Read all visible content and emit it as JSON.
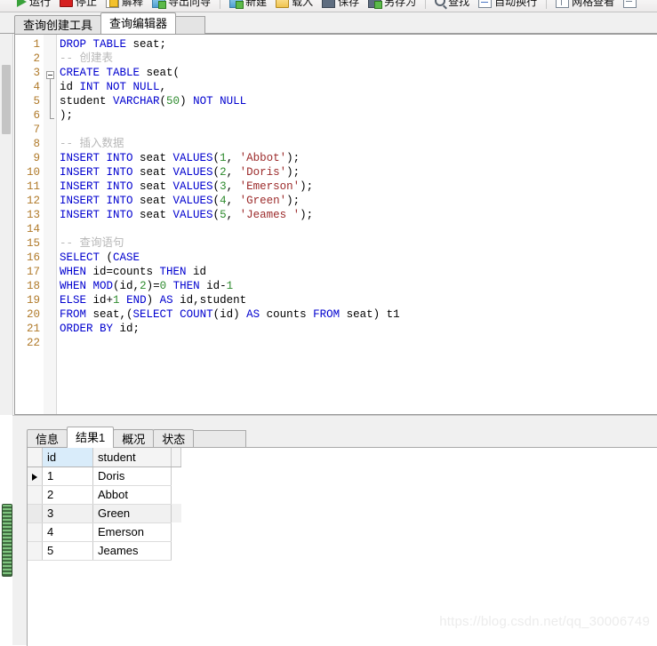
{
  "toolbar": {
    "groups": [
      {
        "items": [
          {
            "label": "运行",
            "icon": "run-icon"
          },
          {
            "label": "停止",
            "icon": "stop-icon"
          },
          {
            "label": "解释",
            "icon": "explain-icon"
          },
          {
            "label": "导出向导",
            "icon": "export-wizard-icon"
          }
        ]
      },
      {
        "items": [
          {
            "label": "新建",
            "icon": "new-icon"
          },
          {
            "label": "载入",
            "icon": "open-icon"
          },
          {
            "label": "保存",
            "icon": "save-icon"
          },
          {
            "label": "另存为",
            "icon": "save-as-icon"
          }
        ]
      },
      {
        "items": [
          {
            "label": "查找",
            "icon": "search-icon"
          },
          {
            "label": "自动换行",
            "icon": "word-wrap-icon"
          }
        ]
      },
      {
        "items": [
          {
            "label": "网格查看",
            "icon": "grid-view-icon"
          },
          {
            "label": "",
            "icon": "form-view-icon"
          }
        ]
      }
    ]
  },
  "tabs": [
    {
      "label": "查询创建工具",
      "active": false
    },
    {
      "label": "查询编辑器",
      "active": true
    }
  ],
  "editor": {
    "lines": [
      {
        "num": "1",
        "tokens": [
          {
            "t": "kw",
            "v": "DROP TABLE"
          },
          {
            "t": "p",
            "v": " seat;"
          }
        ]
      },
      {
        "num": "2",
        "tokens": [
          {
            "t": "cmt",
            "v": "-- 创建表"
          }
        ]
      },
      {
        "num": "3",
        "tokens": [
          {
            "t": "kw",
            "v": "CREATE TABLE"
          },
          {
            "t": "p",
            "v": " seat("
          }
        ],
        "fold": "start"
      },
      {
        "num": "4",
        "tokens": [
          {
            "t": "p",
            "v": "id "
          },
          {
            "t": "kw",
            "v": "INT NOT NULL"
          },
          {
            "t": "p",
            "v": ","
          }
        ],
        "fold": "mid"
      },
      {
        "num": "5",
        "tokens": [
          {
            "t": "p",
            "v": "student "
          },
          {
            "t": "kw",
            "v": "VARCHAR"
          },
          {
            "t": "p",
            "v": "("
          },
          {
            "t": "num",
            "v": "50"
          },
          {
            "t": "p",
            "v": ") "
          },
          {
            "t": "kw",
            "v": "NOT NULL"
          }
        ],
        "fold": "mid"
      },
      {
        "num": "6",
        "tokens": [
          {
            "t": "p",
            "v": ");"
          }
        ],
        "fold": "end"
      },
      {
        "num": "7",
        "tokens": []
      },
      {
        "num": "8",
        "tokens": [
          {
            "t": "cmt",
            "v": "-- 插入数据"
          }
        ]
      },
      {
        "num": "9",
        "tokens": [
          {
            "t": "kw",
            "v": "INSERT INTO"
          },
          {
            "t": "p",
            "v": " seat "
          },
          {
            "t": "kw",
            "v": "VALUES"
          },
          {
            "t": "p",
            "v": "("
          },
          {
            "t": "num",
            "v": "1"
          },
          {
            "t": "p",
            "v": ", "
          },
          {
            "t": "str",
            "v": "'Abbot'"
          },
          {
            "t": "p",
            "v": ");"
          }
        ]
      },
      {
        "num": "10",
        "tokens": [
          {
            "t": "kw",
            "v": "INSERT INTO"
          },
          {
            "t": "p",
            "v": " seat "
          },
          {
            "t": "kw",
            "v": "VALUES"
          },
          {
            "t": "p",
            "v": "("
          },
          {
            "t": "num",
            "v": "2"
          },
          {
            "t": "p",
            "v": ", "
          },
          {
            "t": "str",
            "v": "'Doris'"
          },
          {
            "t": "p",
            "v": ");"
          }
        ]
      },
      {
        "num": "11",
        "tokens": [
          {
            "t": "kw",
            "v": "INSERT INTO"
          },
          {
            "t": "p",
            "v": " seat "
          },
          {
            "t": "kw",
            "v": "VALUES"
          },
          {
            "t": "p",
            "v": "("
          },
          {
            "t": "num",
            "v": "3"
          },
          {
            "t": "p",
            "v": ", "
          },
          {
            "t": "str",
            "v": "'Emerson'"
          },
          {
            "t": "p",
            "v": ");"
          }
        ]
      },
      {
        "num": "12",
        "tokens": [
          {
            "t": "kw",
            "v": "INSERT INTO"
          },
          {
            "t": "p",
            "v": " seat "
          },
          {
            "t": "kw",
            "v": "VALUES"
          },
          {
            "t": "p",
            "v": "("
          },
          {
            "t": "num",
            "v": "4"
          },
          {
            "t": "p",
            "v": ", "
          },
          {
            "t": "str",
            "v": "'Green'"
          },
          {
            "t": "p",
            "v": ");"
          }
        ]
      },
      {
        "num": "13",
        "tokens": [
          {
            "t": "kw",
            "v": "INSERT INTO"
          },
          {
            "t": "p",
            "v": " seat "
          },
          {
            "t": "kw",
            "v": "VALUES"
          },
          {
            "t": "p",
            "v": "("
          },
          {
            "t": "num",
            "v": "5"
          },
          {
            "t": "p",
            "v": ", "
          },
          {
            "t": "str",
            "v": "'Jeames '"
          },
          {
            "t": "p",
            "v": ");"
          }
        ]
      },
      {
        "num": "14",
        "tokens": []
      },
      {
        "num": "15",
        "tokens": [
          {
            "t": "cmt",
            "v": "-- 查询语句"
          }
        ]
      },
      {
        "num": "16",
        "tokens": [
          {
            "t": "kw",
            "v": "SELECT"
          },
          {
            "t": "p",
            "v": " ("
          },
          {
            "t": "kw",
            "v": "CASE"
          }
        ]
      },
      {
        "num": "17",
        "tokens": [
          {
            "t": "kw",
            "v": "WHEN"
          },
          {
            "t": "p",
            "v": " id=counts "
          },
          {
            "t": "kw",
            "v": "THEN"
          },
          {
            "t": "p",
            "v": " id"
          }
        ]
      },
      {
        "num": "18",
        "tokens": [
          {
            "t": "kw",
            "v": "WHEN"
          },
          {
            "t": "p",
            "v": " "
          },
          {
            "t": "kw",
            "v": "MOD"
          },
          {
            "t": "p",
            "v": "(id,"
          },
          {
            "t": "num",
            "v": "2"
          },
          {
            "t": "p",
            "v": ")="
          },
          {
            "t": "num",
            "v": "0"
          },
          {
            "t": "p",
            "v": " "
          },
          {
            "t": "kw",
            "v": "THEN"
          },
          {
            "t": "p",
            "v": " id-"
          },
          {
            "t": "num",
            "v": "1"
          }
        ]
      },
      {
        "num": "19",
        "tokens": [
          {
            "t": "kw",
            "v": "ELSE"
          },
          {
            "t": "p",
            "v": " id+"
          },
          {
            "t": "num",
            "v": "1"
          },
          {
            "t": "p",
            "v": " "
          },
          {
            "t": "kw",
            "v": "END"
          },
          {
            "t": "p",
            "v": ") "
          },
          {
            "t": "kw",
            "v": "AS"
          },
          {
            "t": "p",
            "v": " id,student"
          }
        ]
      },
      {
        "num": "20",
        "tokens": [
          {
            "t": "kw",
            "v": "FROM"
          },
          {
            "t": "p",
            "v": " seat,("
          },
          {
            "t": "kw",
            "v": "SELECT"
          },
          {
            "t": "p",
            "v": " "
          },
          {
            "t": "kw",
            "v": "COUNT"
          },
          {
            "t": "p",
            "v": "(id) "
          },
          {
            "t": "kw",
            "v": "AS"
          },
          {
            "t": "p",
            "v": " counts "
          },
          {
            "t": "kw",
            "v": "FROM"
          },
          {
            "t": "p",
            "v": " seat) t1"
          }
        ]
      },
      {
        "num": "21",
        "tokens": [
          {
            "t": "kw",
            "v": "ORDER BY"
          },
          {
            "t": "p",
            "v": " id;"
          }
        ]
      },
      {
        "num": "22",
        "tokens": []
      }
    ]
  },
  "result": {
    "tabs": [
      {
        "label": "信息",
        "active": false
      },
      {
        "label": "结果1",
        "active": true
      },
      {
        "label": "概况",
        "active": false
      },
      {
        "label": "状态",
        "active": false
      }
    ],
    "columns": [
      "id",
      "student"
    ],
    "selected_column": "id",
    "current_row": 1,
    "rows": [
      {
        "id": "1",
        "student": "Doris"
      },
      {
        "id": "2",
        "student": "Abbot"
      },
      {
        "id": "3",
        "student": "Green"
      },
      {
        "id": "4",
        "student": "Emerson"
      },
      {
        "id": "5",
        "student": "Jeames"
      }
    ]
  },
  "watermark": "https://blog.csdn.net/qq_30006749"
}
